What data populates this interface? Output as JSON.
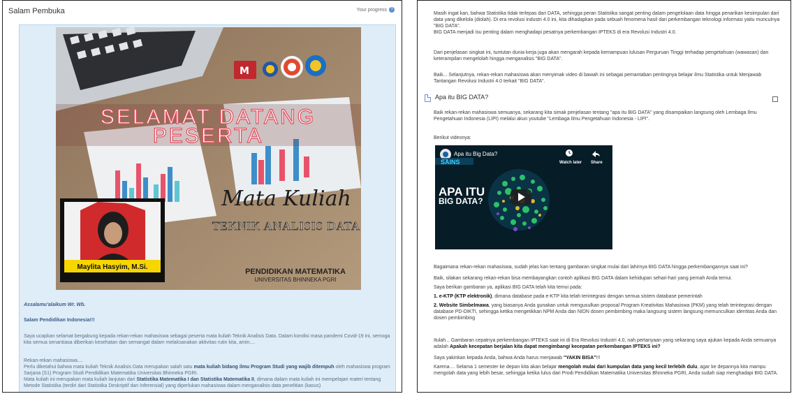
{
  "left": {
    "title": "Salam Pembuka",
    "progress_label": "Your progress",
    "banner": {
      "line1": "SELAMAT DATANG",
      "line2": "PESERTA",
      "subject_script": "Mata Kuliah",
      "subject_caps": "TEKNIK ANALISIS DATA",
      "lecturer": "Maylita Hasyim, M.Si.",
      "program": "PENDIDIKAN MATEMATIKA",
      "university": "UNIVERSITAS BHINNEKA PGRI"
    },
    "greeting": "Assalamu'alaikum Wr. Wb.",
    "salutation": "Salam Pendidikan Indonesia!!!",
    "p1": "Saya ucapkan selamat bergabung kepada rekan-rekan mahasiswa sebagai peserta mata kuliah Teknik Analisis Data. Dalam kondisi masa pandemi Covid-19 ini, semoga kita semua senantiasa diberikan kesehatan dan semangat dalam melaksanakan aktivitas rutin kita, amin....",
    "p2_intro": "Rekan-rekan mahasiswa....",
    "p2a": "Perlu diketahui bahwa mata kuliah Teknik Analisis Data merupakan salah satu ",
    "p2a_bold": "mata kuliah bidang ilmu Program Studi yang wajib ditempuh",
    "p2a_end": " oleh mahasiswa program Sarjana (S1) Program Studi Pendidikan Matematika Universitas Bhinneka PGRI.",
    "p2b": "Mata kuliah ini merupakan mata kuliah lanjutan dari ",
    "p2b_bold": "Statistika Matematika I dan Statistika Matematika II",
    "p2b_end": ", dimana dalam mata kuliah ini mempelajari materi tentang Metode Statistika (terdiri dari Statistika Deskriptif dan Inferensial) yang diperlukan mahasiswa dalam menganalisis data penelitian (kasus)"
  },
  "right": {
    "p1": "Masih ingat kan, bahwa Statistika tidak terlepas dari DATA, sehingga peran Statistika sangat penting dalam pengelolaan data hingga penarikan kesimpulan dari data yang dikelola (diolah). Di era revolusi industri 4.0 ini, kita dihadapkan pada sebuah fenomena hasil dari perkembangan teknologi informasi yaitu munculnya \"BIG DATA\".",
    "p2": "BIG DATA menjadi isu penting dalam menghadapi pesatnya perkembangan IPTEKS di era Revolusi Industri 4.0.",
    "p3": "Dari penjelasan singkat ini, tuntutan dunia kerja juga akan mengarah kepada kemampuan lulusan Perguruan Tinggi terhadap pengetahuan (wawasan) dan keterampilan mengelolah hingga menganalisis \"BIG DATA\".",
    "p4": "Baik... Selanjutnya, rekan-rekan mahasiswa akan menyimak video di bawah ini sebagai pemantaban pentingnya belajar ilmu Statistika untuk Menjawab Tantangan Revolusi Industri 4.0 terkait \"BIG DATA\".",
    "section_title": "Apa itu BIG DATA?",
    "p5": "Baik rekan-rekan mahasiswa semuanya, sekarang kita simak penjelasan tentang \"apa itu BIG DATA\" yang disampaikan langsung oleh Lembaga Ilmu Pengetahuan Indonesia (LIPI) melalui akun youtube \"Lembaga Ilmu Pengetahuan Indonesia - LIPI\".",
    "p6": "Berikut videonya:",
    "video": {
      "title": "Apa itu Big Data?",
      "channel": "SAINS",
      "watch_later": "Watch later",
      "share": "Share",
      "overlay_line1": "APA ITU",
      "overlay_line2": "BIG DATA?"
    },
    "p7": "Bagaimana rekan-rekan mahasiswa, sudah jelas kan tentang gambaran singkat mulai dari lahirnya BIG DATA hingga perkembangannya saat ini?",
    "p8": "Baik, silakan sekarang rekan-rekan bisa membayangkan contoh aplikasi BIG DATA dalam kehidupan sehari-hari yang pernah Anda temui.",
    "p9": "Saya berikan gambaran ya, aplikasi BIG DATA telah kita temui pada:",
    "li1_bold": "1. e-KTP (KTP elektronik)",
    "li1": ", dimana database pada e-KTP kita telah terintegrasi dengan semua sistem database pemerintah",
    "li2_bold": "2. Website Simbelmawa",
    "li2": ", yang biasanya Anda gunakan untuk mengusulkan proposal Program Kreativitas Mahasiswa (PKM) yang telah terintegrasi dengan database PD-DIKTI, sehingga ketika mengetikkan NPM Anda dan NIDN dosen pembimbing maka langsung sistem langsung memunculkan identitas Anda dan dosen pembimbing",
    "p10": "Itulah... Gambaran cepatnya perkembangan IPTEKS saat ini di Era Revolusi Industri 4.0, nah pertanyaan yang sekarang saya ajukan kepada Anda semuanya adalah ",
    "p10_bold": "Apakah kecepatan berjalan kita dapat mengimbangi kecepatan perkembangan IPTEKS ini?",
    "p11": "Saya yakinkan kepada Anda, bahwa Anda harus menjawab ",
    "p11_bold": "\"YAKIN BISA\"",
    "p11_end": "!!!",
    "p12": "Karena.... Selama 1 semester ke depan kita akan belajar ",
    "p12_bold": "mengolah mulai dari kumpulan data yang kecil terlebih dulu",
    "p12_end": ", agar ke depannya kita mampu mengolah data yang lebih besar, sehingga ketika lulus dari Prodi Pendidikan Matematika Universitas Bhinneka PGRI, Anda sudah siap menghadapi BIG DATA."
  }
}
